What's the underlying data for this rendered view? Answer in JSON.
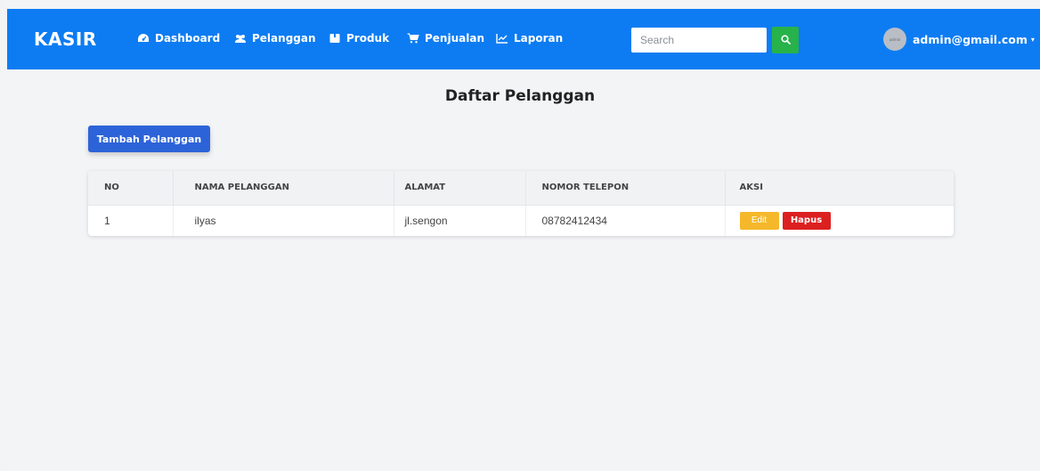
{
  "brand": "KASIR",
  "nav": [
    {
      "label": "Dashboard",
      "icon": "dashboard-icon"
    },
    {
      "label": "Pelanggan",
      "icon": "users-icon"
    },
    {
      "label": "Produk",
      "icon": "box-icon"
    },
    {
      "label": "Penjualan",
      "icon": "cart-icon"
    },
    {
      "label": "Laporan",
      "icon": "chart-icon"
    }
  ],
  "search": {
    "placeholder": "Search",
    "value": ""
  },
  "user": {
    "email": "admin@gmail.com",
    "avatar_text": "admin"
  },
  "page": {
    "title": "Daftar Pelanggan",
    "add_button": "Tambah Pelanggan"
  },
  "table": {
    "headers": [
      "NO",
      "NAMA PELANGGAN",
      "ALAMAT",
      "NOMOR TELEPON",
      "AKSI"
    ],
    "rows": [
      {
        "no": "1",
        "nama": "ilyas",
        "alamat": "jl.sengon",
        "telepon": "08782412434",
        "edit": "Edit",
        "hapus": "Hapus"
      }
    ]
  },
  "colors": {
    "navbar": "#0d7cf2",
    "search_button": "#27b24a",
    "add_button": "#2d63d8",
    "edit_button": "#f5b82a",
    "delete_button": "#dc2020"
  }
}
